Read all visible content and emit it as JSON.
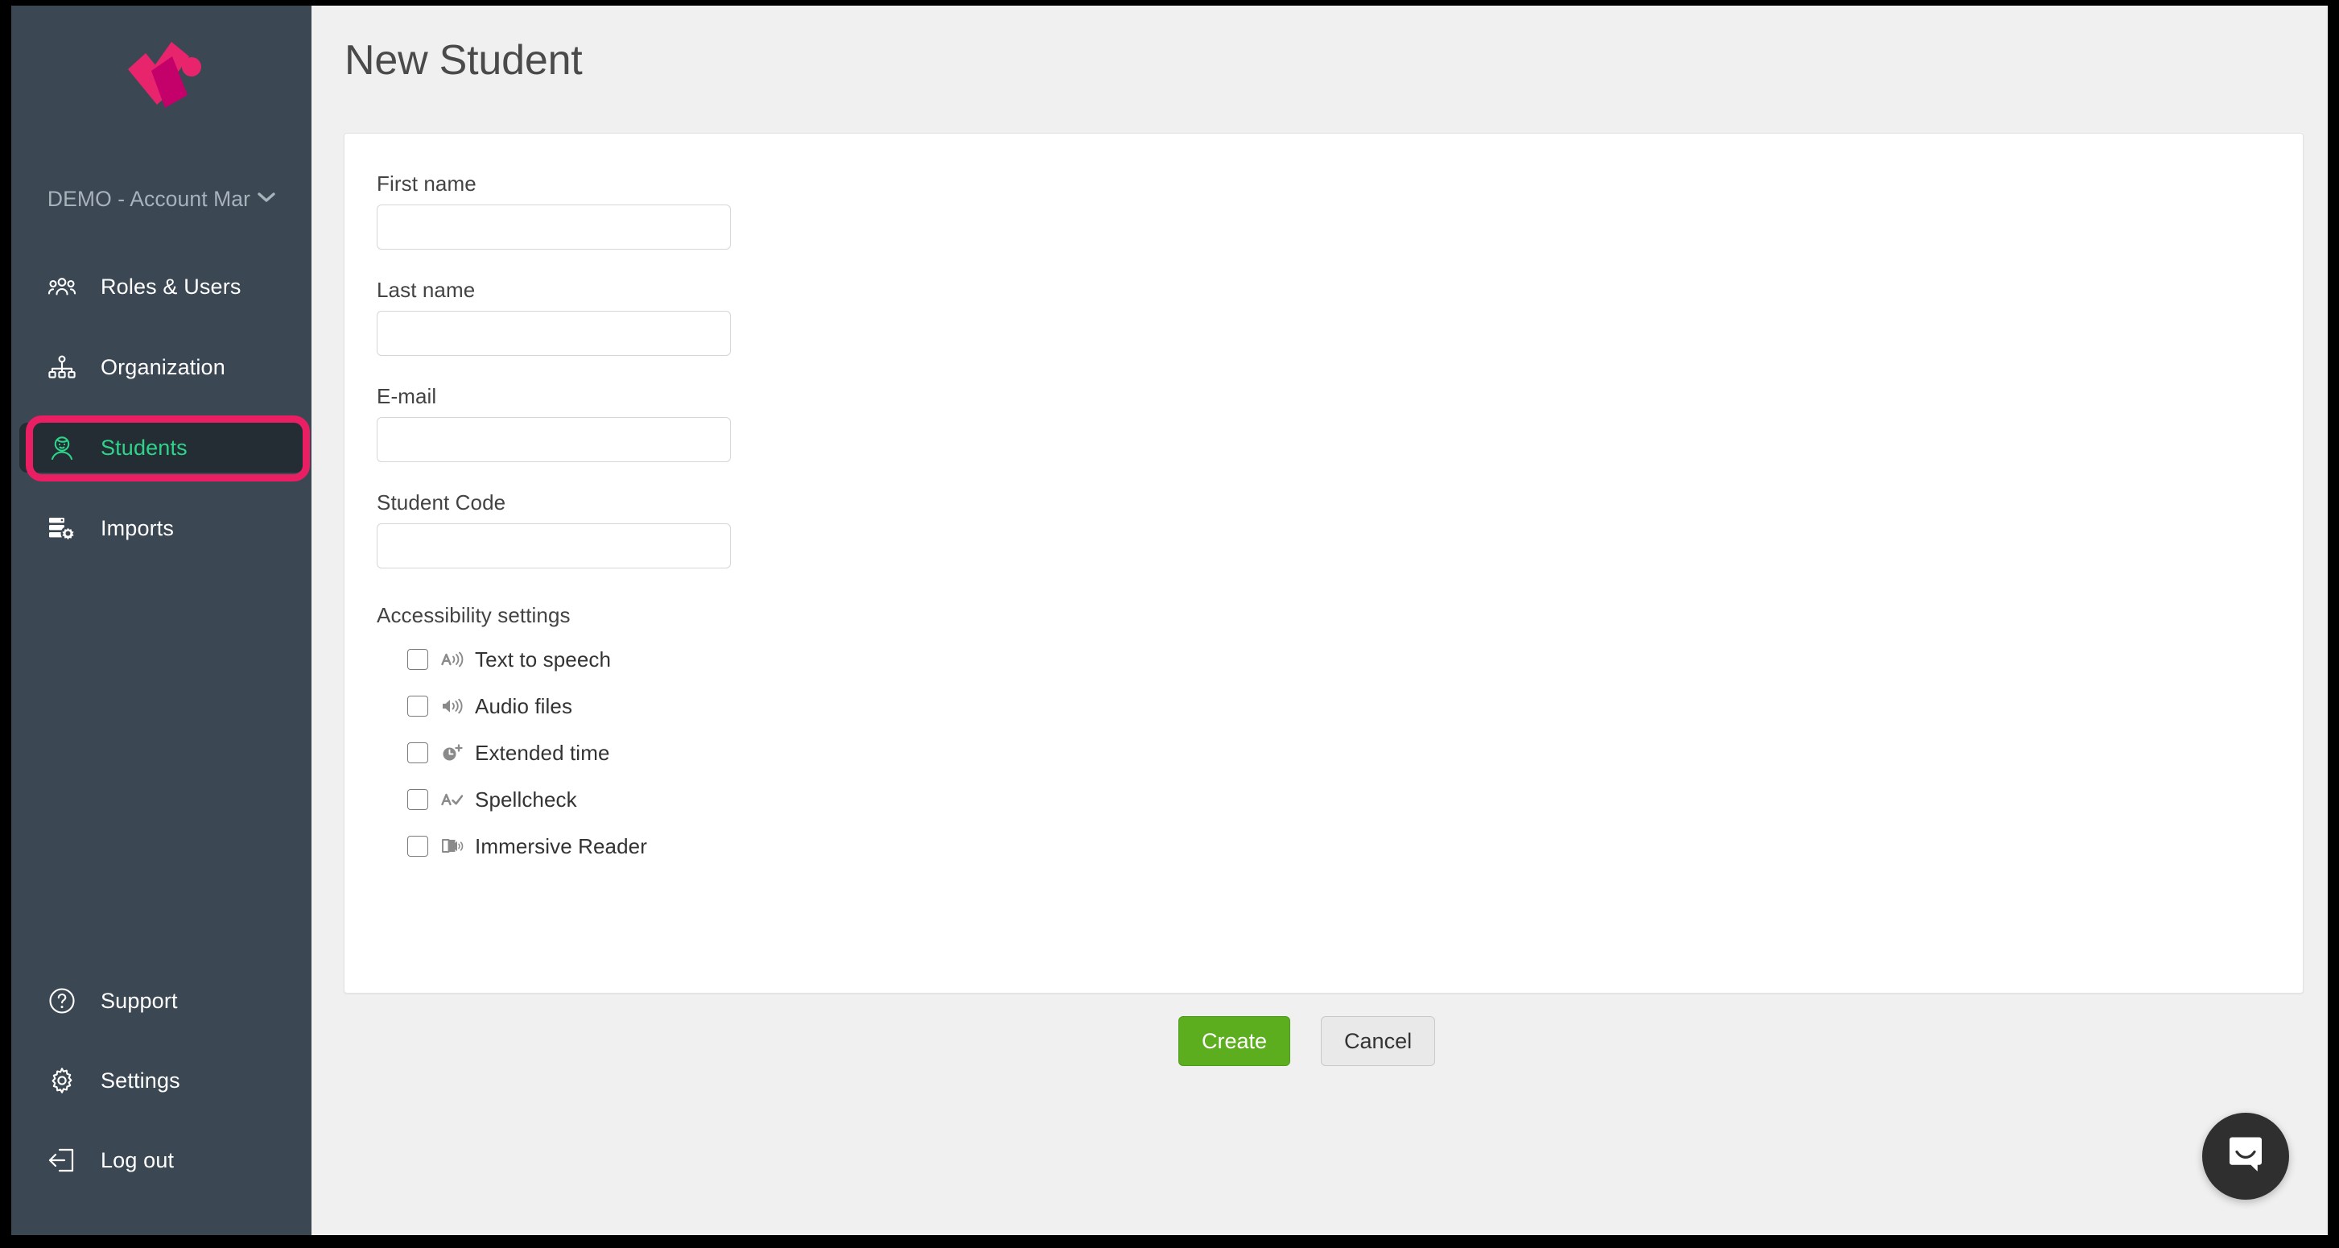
{
  "window": {
    "background_color": "#f0f0f0",
    "frame_color": "#000000"
  },
  "sidebar": {
    "background_color": "#3b4854",
    "logo_name": "kahoot-x-logo",
    "logo_color": "#d6006e",
    "account_switcher": {
      "label": "DEMO - Account Mar",
      "chevron_icon": "chevron-down-icon"
    },
    "active_item_color": "#2dd48a",
    "active_item_background": "#242c34",
    "items": [
      {
        "label": "Roles & Users",
        "icon": "users-group-icon",
        "active": false
      },
      {
        "label": "Organization",
        "icon": "org-chart-icon",
        "active": false
      },
      {
        "label": "Students",
        "icon": "student-face-icon",
        "active": true
      },
      {
        "label": "Imports",
        "icon": "server-gear-icon",
        "active": false
      }
    ],
    "bottom_items": [
      {
        "label": "Support",
        "icon": "question-circle-icon"
      },
      {
        "label": "Settings",
        "icon": "gear-icon"
      },
      {
        "label": "Log out",
        "icon": "logout-arrow-icon"
      }
    ]
  },
  "annotation": {
    "name": "highlight-rectangle",
    "color": "#e91e63",
    "target": "Students"
  },
  "main": {
    "page_title": "New Student",
    "form": {
      "fields": [
        {
          "label": "First name",
          "value": "",
          "placeholder": ""
        },
        {
          "label": "Last name",
          "value": "",
          "placeholder": ""
        },
        {
          "label": "E-mail",
          "value": "",
          "placeholder": ""
        },
        {
          "label": "Student Code",
          "value": "",
          "placeholder": ""
        }
      ],
      "accessibility": {
        "title": "Accessibility settings",
        "options": [
          {
            "label": "Text to speech",
            "icon": "text-to-speech-icon",
            "checked": false
          },
          {
            "label": "Audio files",
            "icon": "speaker-icon",
            "checked": false
          },
          {
            "label": "Extended time",
            "icon": "clock-plus-icon",
            "checked": false
          },
          {
            "label": "Spellcheck",
            "icon": "spellcheck-icon",
            "checked": false
          },
          {
            "label": "Immersive Reader",
            "icon": "immersive-reader-icon",
            "checked": false
          }
        ]
      },
      "actions": {
        "create_label": "Create",
        "create_color": "#5cae1f",
        "cancel_label": "Cancel",
        "cancel_color": "#e9e9e9"
      }
    }
  },
  "chat": {
    "launcher_icon": "chat-bubble-icon",
    "background_color": "#2f2f2f"
  }
}
